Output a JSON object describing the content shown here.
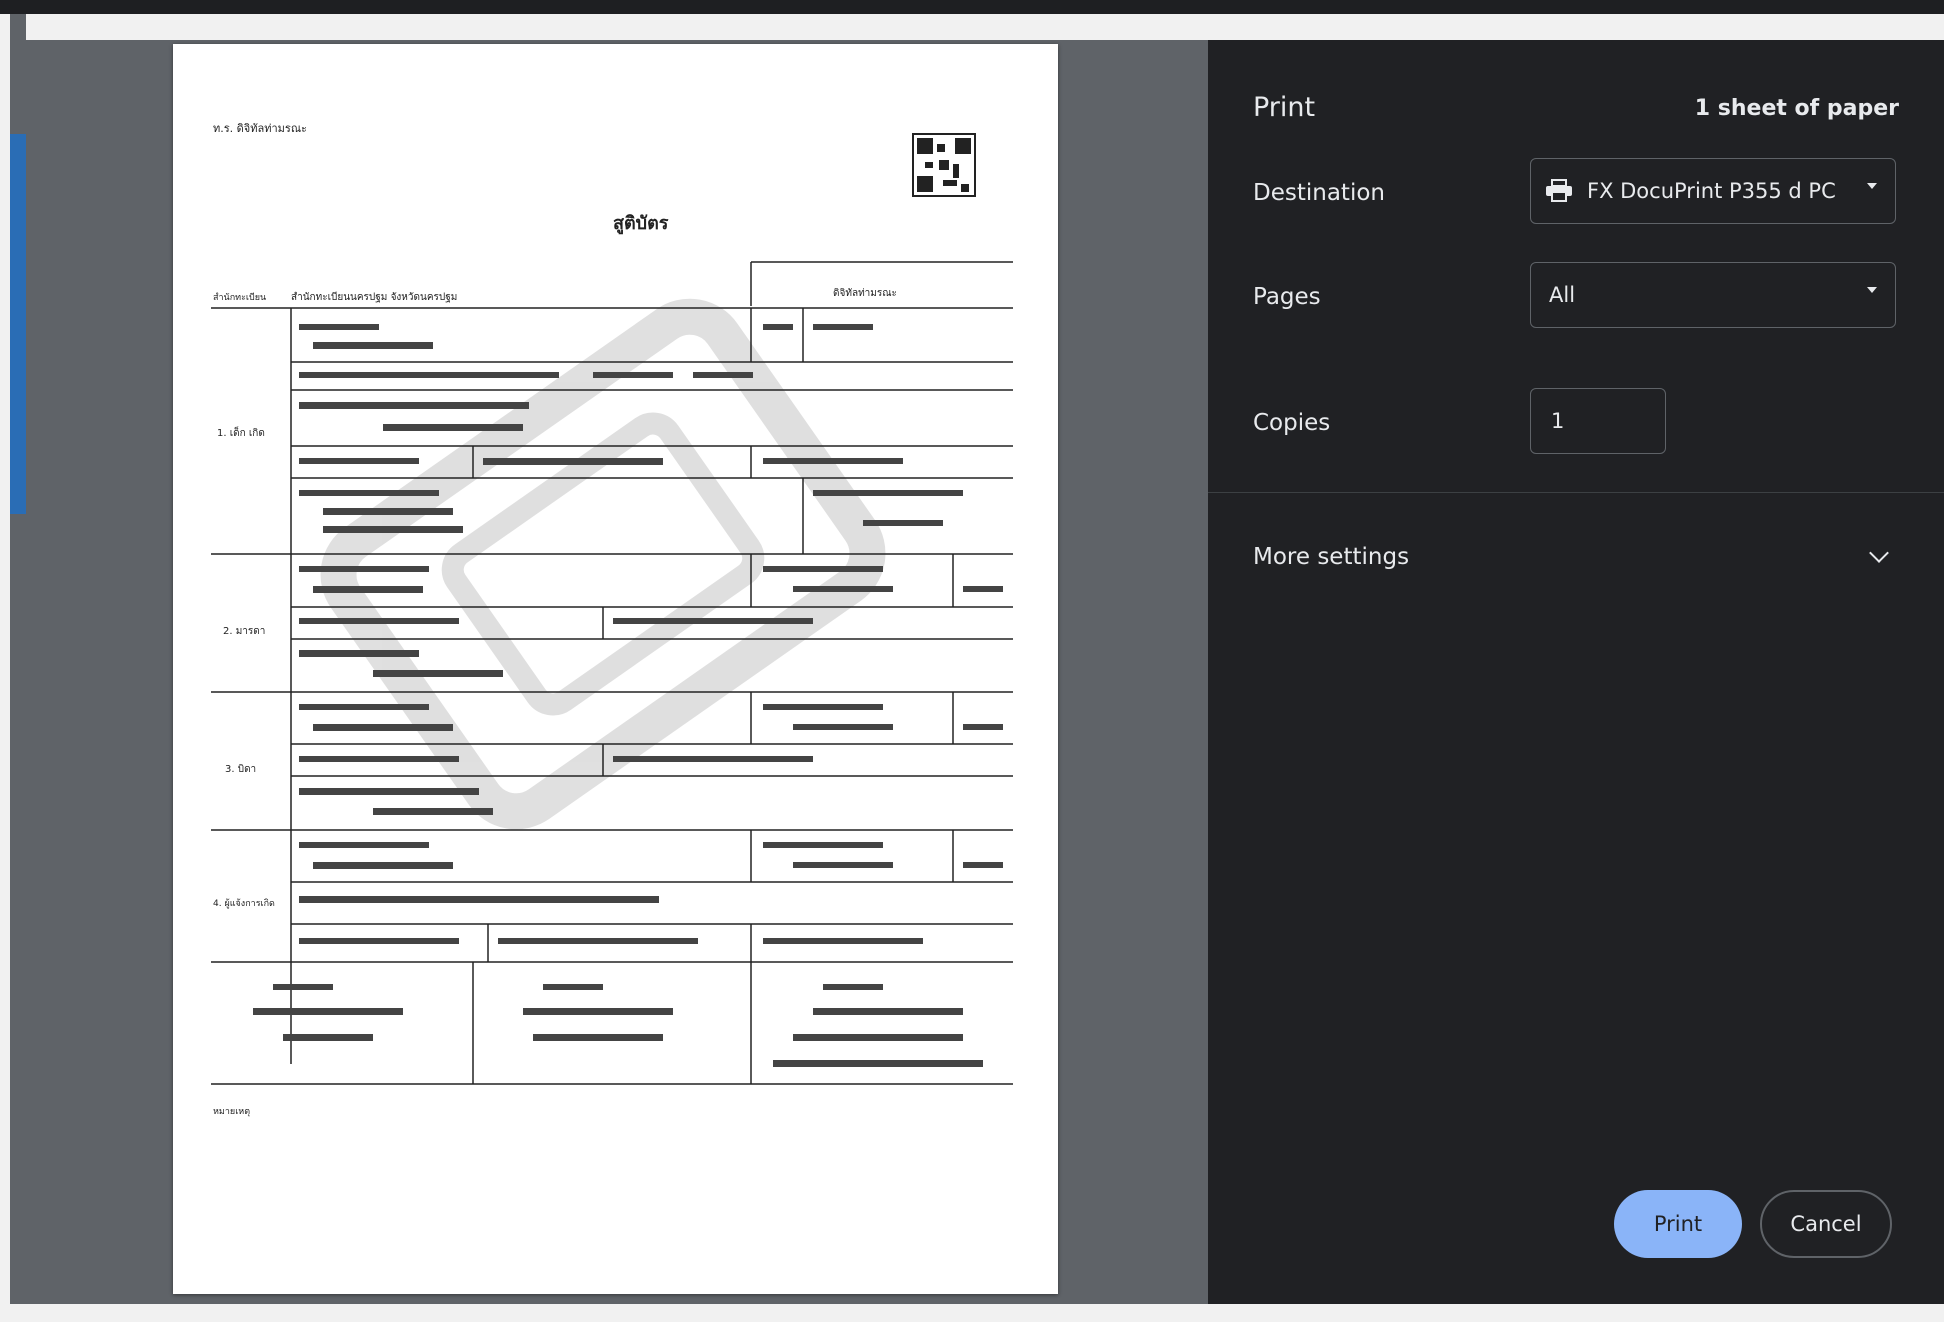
{
  "panel": {
    "title": "Print",
    "sheet_count": "1 sheet of paper",
    "destination_label": "Destination",
    "destination_value": "FX DocuPrint P355 d PC",
    "pages_label": "Pages",
    "pages_value": "All",
    "copies_label": "Copies",
    "copies_value": "1",
    "more_settings_label": "More settings",
    "print_button": "Print",
    "cancel_button": "Cancel"
  },
  "document": {
    "doc_number_header": "ท.ร. ดิจิทัลท่ามรณะ",
    "title": "สูติบัตร",
    "office_header": "ดิจิทัลท่ามรณะ",
    "office_label": "สำนักทะเบียน",
    "office_value": "สำนักทะเบียนนครปฐม จังหวัดนครปฐม",
    "section_1": "1. เด็ก เกิด",
    "section_2": "2. มารดา",
    "section_3": "3. บิดา",
    "section_4": "4. ผู้แจ้งการเกิด",
    "footer_label": "หมายเหตุ"
  },
  "colors": {
    "panel_bg": "#202124",
    "preview_bg": "#5f6368",
    "print_button": "#8ab4f8"
  }
}
